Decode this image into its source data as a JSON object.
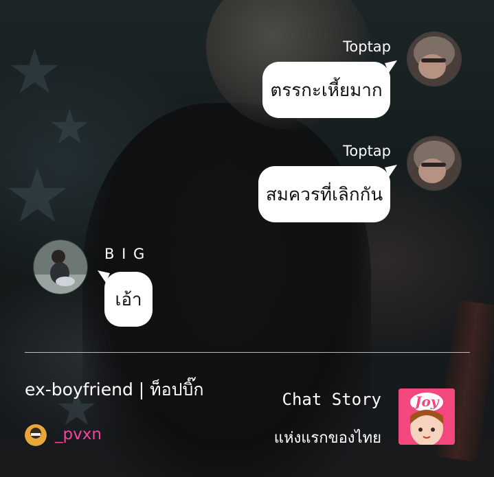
{
  "messages": [
    {
      "sender": "Toptap",
      "text": "ตรรกะเหี้ยมาก",
      "side": "right"
    },
    {
      "sender": "Toptap",
      "text": "สมควรที่เลิกกัน",
      "side": "right"
    },
    {
      "sender": "B I G",
      "text": "เอ้า",
      "side": "left"
    }
  ],
  "footer": {
    "story_title": "ex-boyfriend | ท็อปบิ๊ก",
    "author": "_pvxn",
    "brand_line1": "Chat Story",
    "brand_line2": "แห่งแรกของไทย",
    "logo_text": "Joy"
  },
  "colors": {
    "bubble": "#ffffff",
    "author": "#ff3fa0",
    "logo_bg": "#f4477d"
  }
}
